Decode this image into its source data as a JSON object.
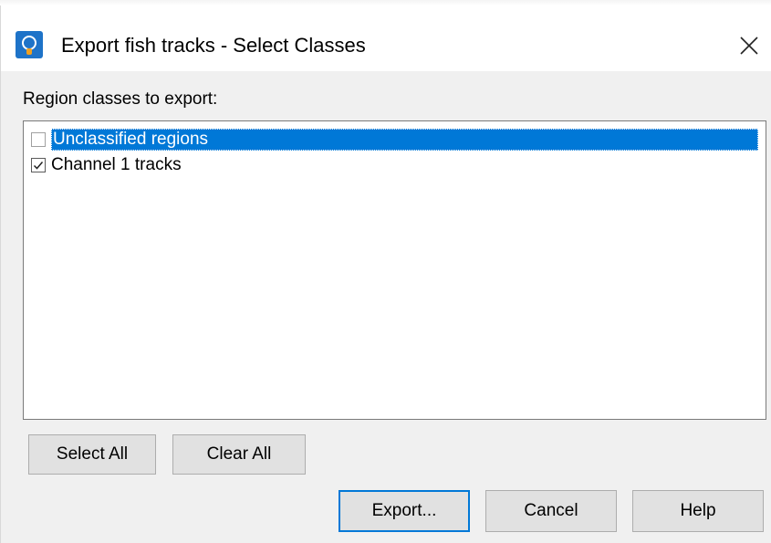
{
  "window": {
    "title": "Export fish tracks - Select Classes",
    "icon": "echoview-app-icon",
    "close_icon": "close-icon"
  },
  "section": {
    "label": "Region classes to export:"
  },
  "list": {
    "items": [
      {
        "label": "Unclassified regions",
        "checked": false,
        "selected": true
      },
      {
        "label": "Channel 1 tracks",
        "checked": true,
        "selected": false
      }
    ]
  },
  "buttons": {
    "select_all": "Select All",
    "clear_all": "Clear All",
    "export": "Export...",
    "cancel": "Cancel",
    "help": "Help"
  },
  "colors": {
    "selection": "#0078d7",
    "dialog_bg": "#f0f0f0",
    "button_bg": "#e1e1e1",
    "app_icon": "#1e73c8"
  }
}
